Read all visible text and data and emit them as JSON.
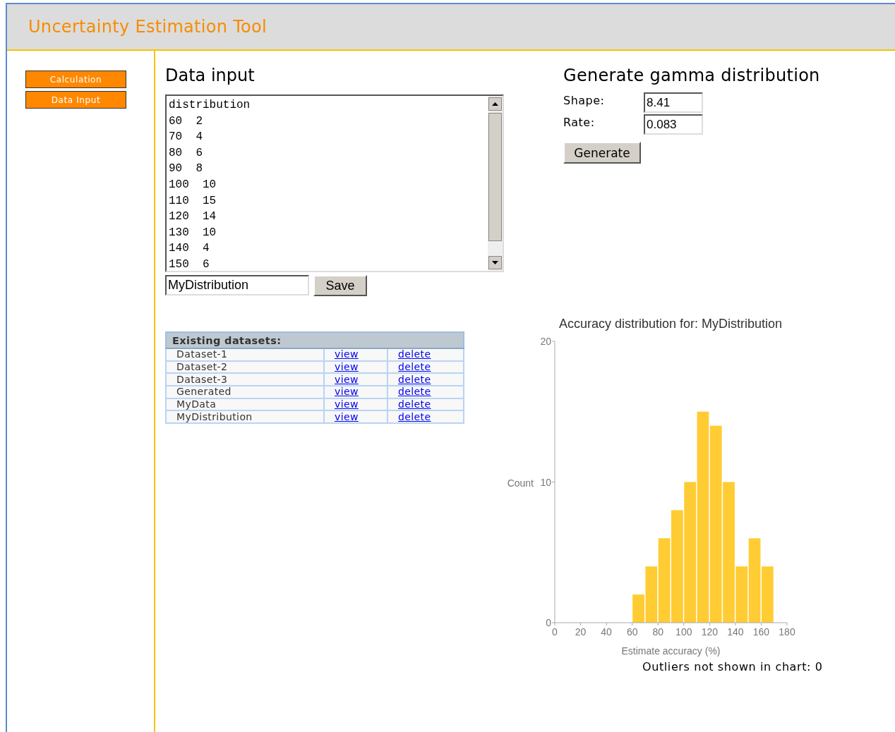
{
  "header": {
    "title": "Uncertainty Estimation Tool"
  },
  "sidebar": {
    "buttons": [
      {
        "label": "Calculation"
      },
      {
        "label": "Data Input"
      }
    ]
  },
  "data_input": {
    "heading": "Data input",
    "lines": [
      "distribution",
      "60  2",
      "70  4",
      "80  6",
      "90  8",
      "100  10",
      "110  15",
      "120  14",
      "130  10",
      "140  4",
      "150  6"
    ],
    "name_field": {
      "value": "MyDistribution"
    },
    "save_button": "Save"
  },
  "datasets": {
    "heading": "Existing datasets:",
    "rows": [
      {
        "name": "Dataset-1",
        "view": "view",
        "delete": "delete"
      },
      {
        "name": "Dataset-2",
        "view": "view",
        "delete": "delete"
      },
      {
        "name": "Dataset-3",
        "view": "view",
        "delete": "delete"
      },
      {
        "name": "Generated",
        "view": "view",
        "delete": "delete"
      },
      {
        "name": "MyData",
        "view": "view",
        "delete": "delete"
      },
      {
        "name": "MyDistribution",
        "view": "view",
        "delete": "delete"
      }
    ]
  },
  "generate": {
    "heading": "Generate gamma distribution",
    "fields": [
      {
        "label": "Shape:",
        "value": "8.41"
      },
      {
        "label": "Rate:",
        "value": "0.083"
      }
    ],
    "button": "Generate"
  },
  "chart": {
    "chart_data": {
      "type": "bar",
      "title": "Accuracy distribution for: MyDistribution",
      "xlabel": "Estimate accuracy (%)",
      "ylabel": "Count",
      "x": [
        65,
        75,
        85,
        95,
        105,
        115,
        125,
        135,
        145,
        155,
        165
      ],
      "values": [
        2,
        4,
        6,
        8,
        10,
        15,
        14,
        10,
        4,
        6,
        4
      ],
      "xlim": [
        0,
        180
      ],
      "ylim": [
        0,
        20
      ],
      "xticks": [
        0,
        20,
        40,
        60,
        80,
        100,
        120,
        140,
        160,
        180
      ],
      "yticks": [
        0,
        10,
        20
      ]
    }
  },
  "outliers": "Outliers not shown in chart: 0"
}
